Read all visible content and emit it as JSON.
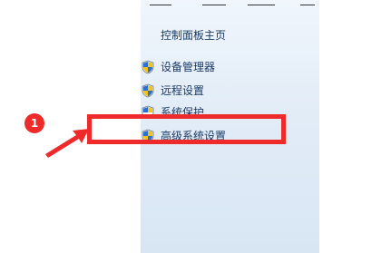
{
  "sidebar": {
    "home_link": "控制面板主页",
    "tasks": [
      {
        "label": "设备管理器",
        "icon": "uac-shield-icon"
      },
      {
        "label": "远程设置",
        "icon": "uac-shield-icon"
      },
      {
        "label": "系统保护",
        "icon": "uac-shield-icon"
      },
      {
        "label": "高级系统设置",
        "icon": "uac-shield-icon"
      }
    ]
  },
  "annotation": {
    "step_number": "1",
    "color": "#ee2a2a"
  }
}
